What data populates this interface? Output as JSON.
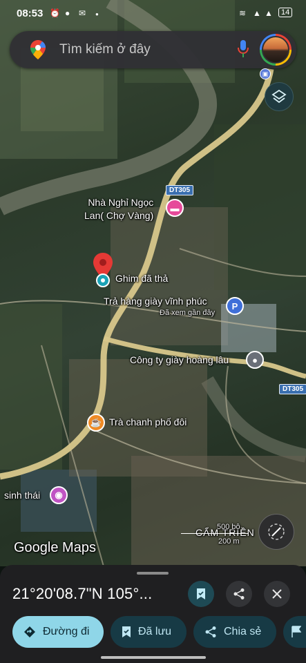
{
  "status_bar": {
    "time": "08:53",
    "battery": "14"
  },
  "search": {
    "placeholder": "Tìm kiếm ở đây"
  },
  "map": {
    "labels": {
      "hotel_line1": "Nhà Nghỉ Ngọc",
      "hotel_line2": "Lan( Chợ Vàng)",
      "dropped_pin": "Ghim đã thả",
      "shoe_store": "Trả hàng giày vĩnh phúc",
      "shoe_store_sub": "Đã xem gần đây",
      "shoe_company": "Công ty giày hoàng lâu",
      "tea_shop": "Trà chanh phố đôi",
      "eco": "sinh thái",
      "area": "CẨM TRIỀN",
      "road_dt305_top": "DT305",
      "road_dt305_right": "DT305",
      "scale_ft": "500 bộ",
      "scale_m": "200 m",
      "logo": "Google Maps",
      "poi_p": "P"
    },
    "colors": {
      "road": "#d8c78b",
      "pin": "#e53935",
      "lodging": "#e64a9a",
      "cafe": "#f08a24",
      "shop": "#3f6fd8"
    }
  },
  "sheet": {
    "coordinates": "21°20'08.7\"N 105°...",
    "actions": {
      "directions": "Đường đi",
      "saved": "Đã lưu",
      "share": "Chia sẻ"
    }
  },
  "icons": [
    "google-maps-pin-icon",
    "mic-icon",
    "layers-icon",
    "bus-icon",
    "bookmark-icon",
    "share-icon",
    "close-icon",
    "directions-icon",
    "compass-icon",
    "flag-icon"
  ]
}
